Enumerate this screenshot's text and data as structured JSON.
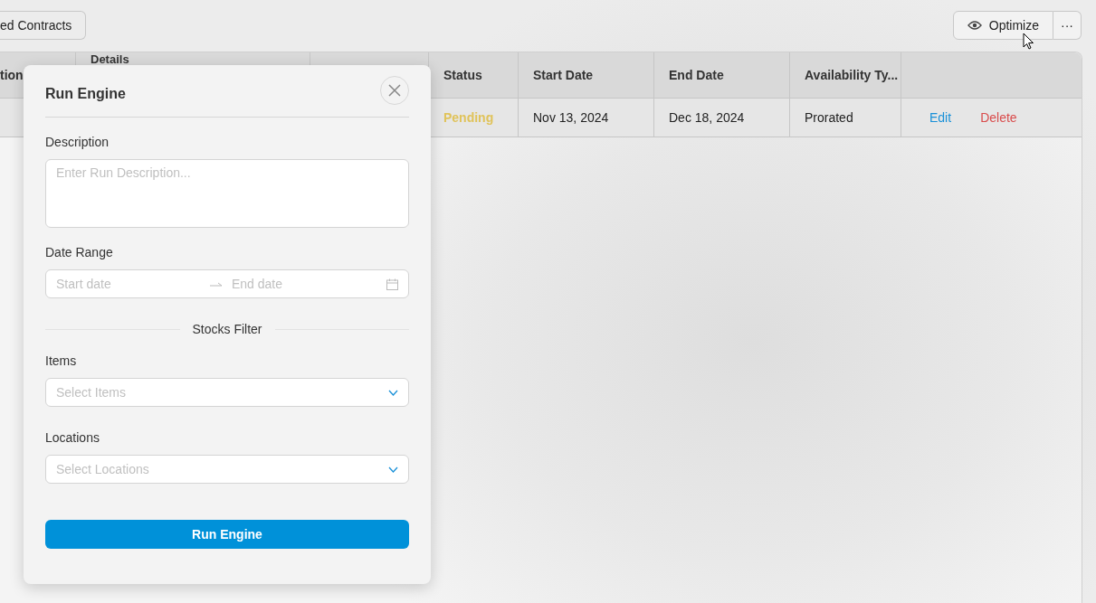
{
  "toolbar": {
    "contracts_button": "ed Contracts",
    "optimize_button": "Optimize",
    "more_button": "···"
  },
  "table": {
    "columns": [
      {
        "kind": "text",
        "label": "tion"
      },
      {
        "kind": "text",
        "label": "Details"
      },
      {
        "kind": "empty"
      },
      {
        "kind": "text",
        "label": "Status"
      },
      {
        "kind": "text",
        "label": "Start Date"
      },
      {
        "kind": "text",
        "label": "End Date"
      },
      {
        "kind": "text",
        "label": "Availability Ty..."
      },
      {
        "kind": "empty"
      }
    ],
    "rows": [
      {
        "status": "Pending",
        "start_date": "Nov 13, 2024",
        "end_date": "Dec 18, 2024",
        "availability_type": "Prorated",
        "actions": [
          {
            "kind": "edit",
            "label": "Edit"
          },
          {
            "kind": "delete",
            "label": "Delete"
          }
        ]
      }
    ]
  },
  "modal": {
    "title": "Run Engine",
    "description": {
      "label": "Description",
      "placeholder": "Enter Run Description..."
    },
    "date_range": {
      "label": "Date Range",
      "start_placeholder": "Start date",
      "end_placeholder": "End date"
    },
    "section": "Stocks Filter",
    "items": {
      "label": "Items",
      "placeholder": "Select Items"
    },
    "locations": {
      "label": "Locations",
      "placeholder": "Select Locations"
    },
    "submit_button": "Run Engine"
  }
}
